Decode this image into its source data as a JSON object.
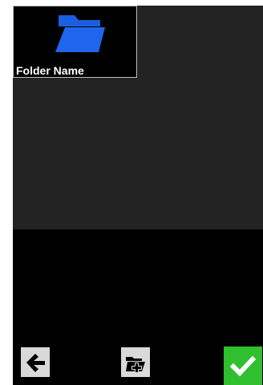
{
  "folder_browser": {
    "items": [
      {
        "label": "Folder Name",
        "icon": "folder-icon",
        "icon_color": "#1a5fe0"
      }
    ]
  },
  "toolbar": {
    "back": {
      "icon": "arrow-left-icon"
    },
    "new_folder": {
      "icon": "folder-plus-icon"
    },
    "confirm": {
      "icon": "checkmark-icon",
      "color": "#2fbf2f"
    }
  }
}
